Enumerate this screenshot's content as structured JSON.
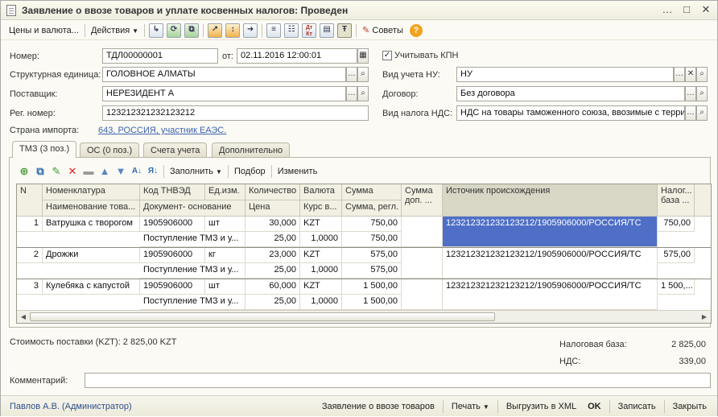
{
  "window": {
    "title": "Заявление о ввозе товаров и уплате косвенных налогов: Проведен",
    "controls": [
      "…",
      "□",
      "✕"
    ]
  },
  "toolbar": {
    "prices_label": "Цены и валюта...",
    "actions_label": "Действия",
    "advice_label": "Советы",
    "dtkt_label": "Дт Кт"
  },
  "form": {
    "number_label": "Номер:",
    "number_value": "ТДЛ00000001",
    "date_label": "от:",
    "date_value": "02.11.2016 12:00:01",
    "kpn_label": "Учитывать КПН",
    "kpn_checked": "✓",
    "unit_label": "Структурная единица:",
    "unit_value": "ГОЛОВНОЕ АЛМАТЫ",
    "nu_label": "Вид учета НУ:",
    "nu_value": "НУ",
    "supplier_label": "Поставщик:",
    "supplier_value": "НЕРЕЗИДЕНТ А",
    "contract_label": "Договор:",
    "contract_value": "Без договора",
    "reg_label": "Рег. номер:",
    "reg_value": "123212321232123212",
    "vat_type_label": "Вид налога НДС:",
    "vat_type_value": "НДС на товары таможенного союза, ввозимые с терри",
    "country_label": "Страна импорта:",
    "country_value": "643, РОССИЯ, участник ЕАЭС."
  },
  "tabs": [
    {
      "label": "ТМЗ (3 поз.)"
    },
    {
      "label": "ОС (0 поз.)"
    },
    {
      "label": "Счета учета"
    },
    {
      "label": "Дополнительно"
    }
  ],
  "table_toolbar": {
    "fill_label": "Заполнить",
    "select_label": "Подбор",
    "edit_label": "Изменить"
  },
  "table": {
    "headers_top": [
      "N",
      "Номенклатура",
      "Код ТНВЭД",
      "Ед.изм.",
      "Количество",
      "Валюта",
      "Сумма",
      "Сумма доп. ...",
      "Источник происхождения",
      "Налог... база ..."
    ],
    "headers_bottom": [
      "Наименование това...",
      "Документ- основание",
      "Цена",
      "Курс в...",
      "Сумма, регл."
    ],
    "rows": [
      {
        "n": "1",
        "name": "Ватрушка с творогом",
        "code": "1905906000",
        "unit": "шт",
        "qty": "30,000",
        "currency": "KZT",
        "sum": "750,00",
        "doc": "Поступление ТМЗ и у...",
        "price": "25,00",
        "rate": "1,0000",
        "sum_regl": "750,00",
        "source": "123212321232123212/1905906000/РОССИЯ/ТС",
        "tax_base": "750,00"
      },
      {
        "n": "2",
        "name": "Дрожжи",
        "code": "1905906000",
        "unit": "кг",
        "qty": "23,000",
        "currency": "KZT",
        "sum": "575,00",
        "doc": "Поступление ТМЗ и у...",
        "price": "25,00",
        "rate": "1,0000",
        "sum_regl": "575,00",
        "source": "123212321232123212/1905906000/РОССИЯ/ТС",
        "tax_base": "575,00"
      },
      {
        "n": "3",
        "name": "Кулебяка с капустой",
        "code": "1905906000",
        "unit": "шт",
        "qty": "60,000",
        "currency": "KZT",
        "sum": "1 500,00",
        "doc": "Поступление ТМЗ и у...",
        "price": "25,00",
        "rate": "1,0000",
        "sum_regl": "1 500,00",
        "source": "123212321232123212/1905906000/РОССИЯ/ТС",
        "tax_base": "1 500,..."
      }
    ]
  },
  "totals": {
    "delivery_cost": "Стоимость поставки (KZT): 2 825,00 KZT",
    "tax_base_label": "Налоговая база:",
    "tax_base_value": "2 825,00",
    "vat_label": "НДС:",
    "vat_value": "339,00"
  },
  "comment": {
    "label": "Комментарий:",
    "value": ""
  },
  "statusbar": {
    "user": "Павлов А.В. (Администратор)",
    "app_label": "Заявление о ввозе товаров",
    "print_label": "Печать",
    "export_label": "Выгрузить в XML",
    "ok_label": "OK",
    "save_label": "Записать",
    "close_label": "Закрыть"
  }
}
